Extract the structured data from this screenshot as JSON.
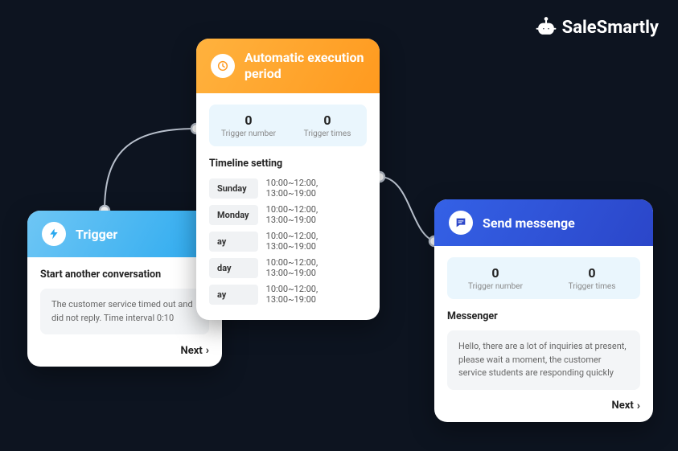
{
  "brand": {
    "name": "SaleSmartly"
  },
  "trigger": {
    "title": "Trigger",
    "section": "Start another conversation",
    "message": "The customer service timed out and did not reply. Time interval 0:10",
    "next": "Next"
  },
  "auto": {
    "title": "Automatic execution period",
    "stats": {
      "trigger_number": {
        "value": "0",
        "label": "Trigger number"
      },
      "trigger_times": {
        "value": "0",
        "label": "Trigger times"
      }
    },
    "timeline_title": "Timeline setting",
    "timeline": [
      {
        "day": "Sunday",
        "times": "10:00~12:00, 13:00~19:00"
      },
      {
        "day": "Monday",
        "times": "10:00~12:00, 13:00~19:00"
      },
      {
        "day": "ay",
        "times": "10:00~12:00, 13:00~19:00"
      },
      {
        "day": "day",
        "times": "10:00~12:00, 13:00~19:00"
      },
      {
        "day": "ay",
        "times": "10:00~12:00, 13:00~19:00"
      }
    ]
  },
  "send": {
    "title": "Send messenge",
    "stats": {
      "trigger_number": {
        "value": "0",
        "label": "Trigger number"
      },
      "trigger_times": {
        "value": "0",
        "label": "Trigger times"
      }
    },
    "channel_title": "Messenger",
    "message": "Hello, there are a lot of inquiries at present, please wait a moment, the customer service students are responding quickly",
    "next": "Next"
  }
}
